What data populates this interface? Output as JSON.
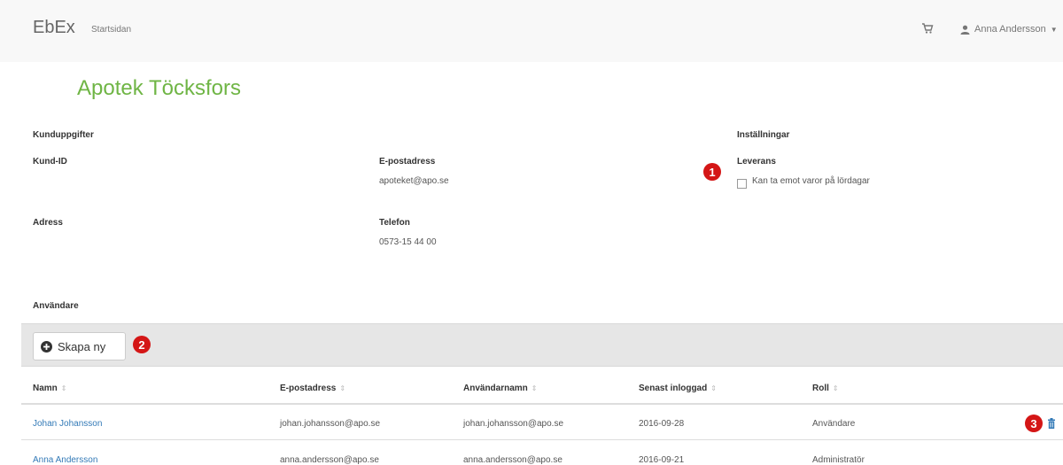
{
  "nav": {
    "brand": "EbEx",
    "home_link": "Startsidan",
    "user_name": "Anna Andersson",
    "icons": [
      "cart-icon",
      "user-icon",
      "caret-down-icon"
    ]
  },
  "page_title": "Apotek Töcksfors",
  "customer": {
    "section_title": "Kunduppgifter",
    "id_label": "Kund-ID",
    "address_label": "Adress",
    "email_label": "E-postadress",
    "email_value": "apoteket@apo.se",
    "phone_label": "Telefon",
    "phone_value": "0573-15 44 00"
  },
  "settings": {
    "section_title": "Inställningar",
    "delivery_label": "Leverans",
    "saturday_checkbox_label": "Kan ta emot varor på lördagar",
    "saturday_checked": false
  },
  "badges": [
    "1",
    "2",
    "3"
  ],
  "users": {
    "section_title": "Användare",
    "create_button": "Skapa ny",
    "columns": [
      "Namn",
      "E-postadress",
      "Användarnamn",
      "Senast inloggad",
      "Roll"
    ],
    "sort_glyph": "⇕",
    "rows": [
      {
        "name": "Johan Johansson",
        "email": "johan.johansson@apo.se",
        "username": "johan.johansson@apo.se",
        "last_login": "2016-09-28",
        "role": "Användare"
      },
      {
        "name": "Anna Andersson",
        "email": "anna.andersson@apo.se",
        "username": "anna.andersson@apo.se",
        "last_login": "2016-09-21",
        "role": "Administratör"
      }
    ]
  },
  "colors": {
    "title_green": "#6fb545",
    "link_blue": "#337ab7",
    "badge_red": "#d41616",
    "navbar_bg": "#f8f8f8",
    "toolbar_bg": "#e6e6e6"
  }
}
